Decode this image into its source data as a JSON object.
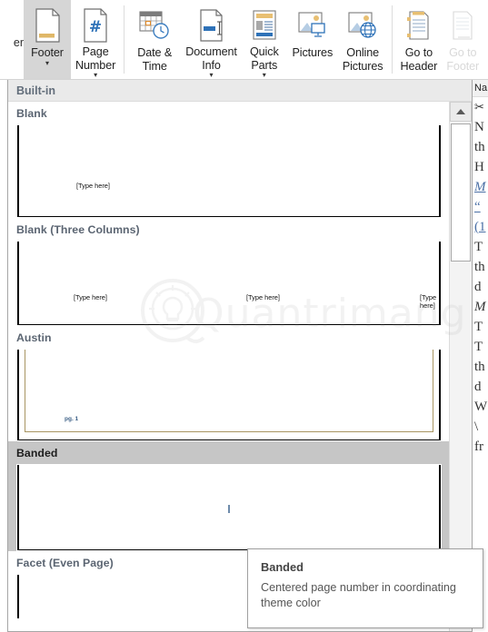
{
  "ribbon": {
    "partial_left_label": "er",
    "buttons": [
      {
        "name": "footer",
        "label": "Footer",
        "icon": "page-footer-icon",
        "has_caret": true,
        "state": "active",
        "disabled": false
      },
      {
        "name": "page-number",
        "label": "Page\nNumber",
        "icon": "page-number-icon",
        "has_caret": true,
        "state": "normal",
        "disabled": false
      },
      {
        "name": "date-time",
        "label": "Date &\nTime",
        "icon": "calendar-clock-icon",
        "has_caret": false,
        "state": "normal",
        "disabled": false
      },
      {
        "name": "document-info",
        "label": "Document\nInfo",
        "icon": "document-info-icon",
        "has_caret": true,
        "state": "normal",
        "disabled": false
      },
      {
        "name": "quick-parts",
        "label": "Quick\nParts",
        "icon": "quick-parts-icon",
        "has_caret": true,
        "state": "normal",
        "disabled": false
      },
      {
        "name": "pictures",
        "label": "Pictures",
        "icon": "pictures-icon",
        "has_caret": false,
        "state": "normal",
        "disabled": false
      },
      {
        "name": "online-pictures",
        "label": "Online\nPictures",
        "icon": "online-pictures-icon",
        "has_caret": false,
        "state": "normal",
        "disabled": false
      },
      {
        "name": "go-to-header",
        "label": "Go to\nHeader",
        "icon": "go-to-header-icon",
        "has_caret": false,
        "state": "normal",
        "disabled": false
      },
      {
        "name": "go-to-footer",
        "label": "Go to\nFooter",
        "icon": "go-to-footer-icon",
        "has_caret": false,
        "state": "normal",
        "disabled": true
      }
    ]
  },
  "gallery": {
    "header": "Built-in",
    "items": [
      {
        "name": "blank",
        "label": "Blank",
        "selected": false,
        "placeholders": [
          "[Type here]"
        ]
      },
      {
        "name": "blank-three-columns",
        "label": "Blank (Three Columns)",
        "selected": false,
        "placeholders": [
          "[Type here]",
          "[Type here]",
          "[Type here]"
        ]
      },
      {
        "name": "austin",
        "label": "Austin",
        "selected": false,
        "page_text": "pg. 1",
        "accent_color": "#a89562"
      },
      {
        "name": "banded",
        "label": "Banded",
        "selected": true,
        "accent_color": "#6e8bab"
      },
      {
        "name": "facet-even-page",
        "label": "Facet (Even Page)",
        "selected": false
      }
    ]
  },
  "watermark": {
    "text": "Quantrimang",
    "icon": "lightbulb-circle-icon"
  },
  "tooltip": {
    "title": "Banded",
    "description": "Centered page number in coordinating theme color"
  },
  "scrollbar": {
    "up_arrow_icon": "caret-up-icon"
  },
  "document_strip": {
    "header": "Na",
    "lines": [
      "N",
      "th",
      "H",
      "M",
      "“",
      "(1",
      "T",
      "th",
      "d",
      "M",
      "T",
      "T",
      "th",
      "d",
      "W",
      "\\",
      "fr"
    ]
  },
  "colors": {
    "ribbon_bg": "#ffffff",
    "active_button": "#d6d6d6",
    "gallery_header_bg": "#eaeaea",
    "selected_item_bg": "#c6c6c6",
    "label_text": "#5b6572",
    "accent_gold": "#a89562",
    "accent_blue": "#3b5f86"
  }
}
